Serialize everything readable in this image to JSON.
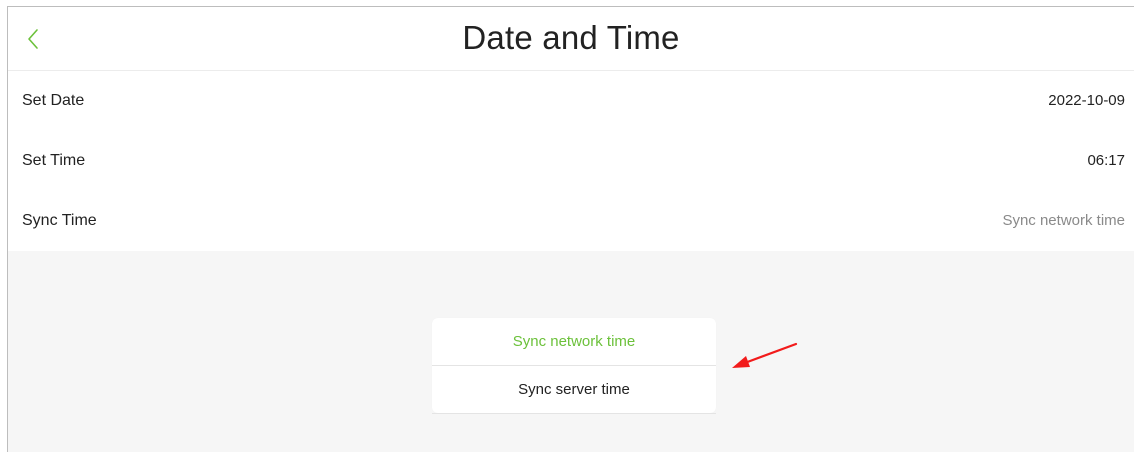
{
  "header": {
    "title": "Date and Time",
    "back_icon": "chevron-left-icon",
    "accent_color": "#6cc13b"
  },
  "settings": [
    {
      "label": "Set Date",
      "value": "2022-10-09"
    },
    {
      "label": "Set Time",
      "value": "06:17"
    },
    {
      "label": "Sync Time",
      "value": "Sync network time"
    }
  ],
  "sync_popup": {
    "options": [
      {
        "label": "Sync network time",
        "selected": true
      },
      {
        "label": "Sync server time",
        "selected": false
      }
    ]
  },
  "annotation": {
    "icon": "red-arrow-icon",
    "color": "#f21b1b"
  }
}
